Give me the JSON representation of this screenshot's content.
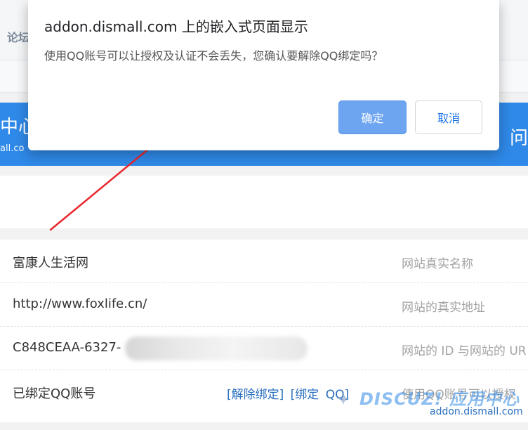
{
  "background": {
    "topbar_crumb": "论坛",
    "banner": {
      "left_title": "中心",
      "left_domain": "all.co",
      "right_text": "问"
    },
    "rows": [
      {
        "label": "富康人生活网",
        "desc": "网站真实名称"
      },
      {
        "label": "http://www.foxlife.cn/",
        "desc": "网站的真实地址"
      },
      {
        "label": "C848CEAA-6327-",
        "desc": "网站的 ID 与网站的 UR"
      },
      {
        "label": "已绑定QQ账号",
        "actions": [
          "[解除绑定]",
          "[绑定",
          "QQ]"
        ],
        "desc": "使用QQ账号可以授权"
      }
    ],
    "watermark": {
      "main": "DISCUZ! 应用中心",
      "sub": "addon.dismall.com"
    }
  },
  "dialog": {
    "title": "addon.dismall.com 上的嵌入式页面显示",
    "message": "使用QQ账号可以让授权及认证不会丢失，您确认要解除QQ绑定吗？",
    "ok_label": "确定",
    "cancel_label": "取消"
  },
  "colors": {
    "banner_blue": "#2f89e8",
    "ok_button": "#6ea5f0",
    "link_blue": "#2a6fbf",
    "arrow_red": "#e8262c"
  }
}
